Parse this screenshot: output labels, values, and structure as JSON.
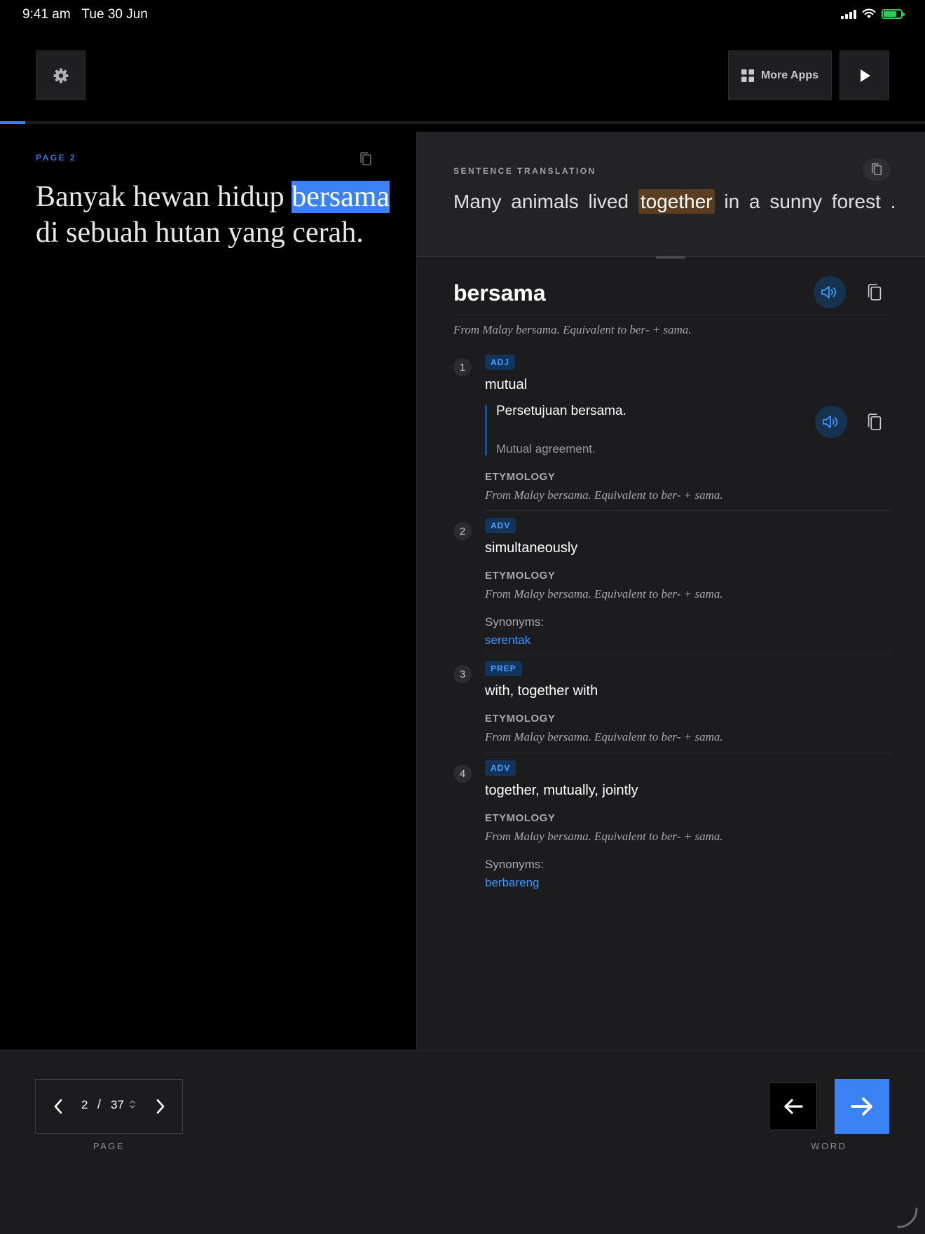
{
  "status_bar": {
    "time": "9:41 am",
    "date": "Tue 30 Jun",
    "battery_color": "#34c759"
  },
  "toolbar": {
    "settings_icon": "gear-icon",
    "more_apps_label": "More Apps",
    "more_apps_icon": "grid-icon",
    "play_icon": "play-icon"
  },
  "reading_progress": {
    "fraction": 0.027
  },
  "source": {
    "page_label": "PAGE  2",
    "words": [
      {
        "text": "Banyak",
        "highlighted": false
      },
      {
        "text": "hewan",
        "highlighted": false
      },
      {
        "text": "hidup",
        "highlighted": false
      },
      {
        "text": "bersama",
        "highlighted": true
      },
      {
        "text": "di",
        "highlighted": false
      },
      {
        "text": "sebuah",
        "highlighted": false
      },
      {
        "text": "hutan",
        "highlighted": false
      },
      {
        "text": "yang",
        "highlighted": false
      },
      {
        "text": "cerah",
        "highlighted": false
      },
      {
        "text": ".",
        "highlighted": false
      }
    ]
  },
  "translation": {
    "label": "SENTENCE TRANSLATION",
    "before": "Many animals lived ",
    "highlight": "together",
    "after": " in a sunny forest ."
  },
  "entry": {
    "headword": "bersama",
    "etymology": "From Malay bersama. Equivalent to ber- + sama.",
    "ety_label": "ETYMOLOGY",
    "synonyms_label": "Synonyms:",
    "senses": [
      {
        "num": "1",
        "pos": "ADJ",
        "gloss": "mutual",
        "example": "Persetujuan bersama.",
        "example_translation": "Mutual agreement.",
        "etymology": "From Malay bersama. Equivalent to ber- + sama."
      },
      {
        "num": "2",
        "pos": "ADV",
        "gloss": "simultaneously",
        "etymology": "From Malay bersama. Equivalent to ber- + sama.",
        "synonym": "serentak"
      },
      {
        "num": "3",
        "pos": "PREP",
        "gloss": "with, together with",
        "etymology": "From Malay bersama. Equivalent to ber- + sama."
      },
      {
        "num": "4",
        "pos": "ADV",
        "gloss": "together, mutually, jointly",
        "etymology": "From Malay bersama. Equivalent to ber- + sama.",
        "synonym": "berbareng"
      }
    ]
  },
  "pager": {
    "current": "2",
    "separator": "/",
    "total": "37",
    "caption": "PAGE"
  },
  "word_nav": {
    "caption": "WORD",
    "accent": "#3b82f6"
  }
}
